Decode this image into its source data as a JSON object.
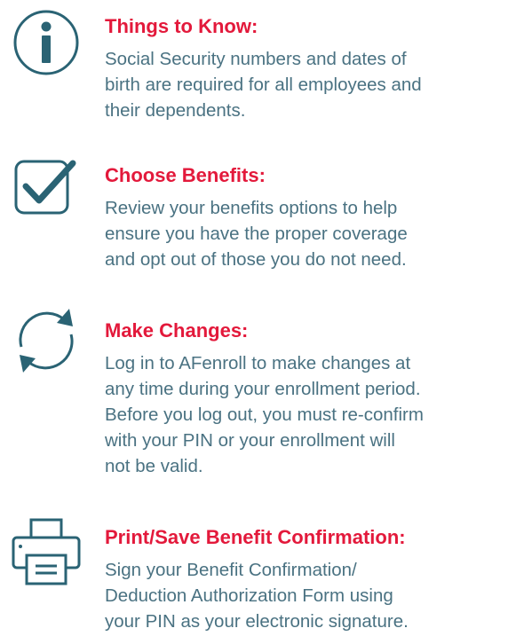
{
  "items": [
    {
      "icon": "info-icon",
      "title": "Things to Know:",
      "lines": [
        "Social Security numbers and dates of",
        "birth are required for all employees and",
        "their dependents."
      ]
    },
    {
      "icon": "checkbox-icon",
      "title": "Choose Benefits:",
      "lines": [
        "Review your benefits options to help",
        "ensure you have the proper coverage",
        "and opt out of those you do not need."
      ]
    },
    {
      "icon": "refresh-icon",
      "title": "Make Changes:",
      "lines": [
        "Log in to AFenroll to make changes at",
        "any time during your enrollment period.",
        "Before you log out, you must re-confirm",
        "with your PIN or your enrollment will",
        "not be valid."
      ]
    },
    {
      "icon": "printer-icon",
      "title": "Print/Save Benefit Confirmation:",
      "lines": [
        "Sign your Benefit Confirmation/",
        "Deduction Authorization Form using",
        "your PIN as your electronic signature."
      ]
    }
  ],
  "colors": {
    "title": "#e3193b",
    "body": "#4a7282",
    "icon": "#2a6374"
  }
}
